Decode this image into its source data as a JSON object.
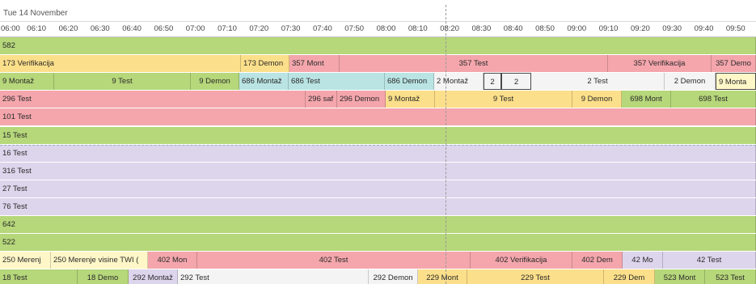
{
  "date_label": "Tue 14 November",
  "colors": {
    "green": "#b6d77a",
    "yellow": "#fcdf8a",
    "red": "#f4a6ac",
    "purple": "#ddd5ec",
    "cyan": "#b9e4e3",
    "white": "#f4f4f4",
    "yellow_light": "#fff7c8"
  },
  "time_ticks": [
    "06:00",
    "06:10",
    "06:20",
    "06:30",
    "06:40",
    "06:50",
    "07:00",
    "07:10",
    "07:20",
    "07:30",
    "07:40",
    "07:50",
    "08:00",
    "08:10",
    "08:20",
    "08:30",
    "08:40",
    "08:50",
    "09:00",
    "09:10",
    "09:20",
    "09:30",
    "09:40",
    "09:50"
  ],
  "rows": [
    {
      "segments": [
        {
          "text": "582",
          "color": "green",
          "start": 0,
          "end": 935,
          "align": "left"
        }
      ]
    },
    {
      "segments": [
        {
          "text": "173 Verifikacija",
          "color": "yellow",
          "start": 0,
          "end": 298,
          "align": "left"
        },
        {
          "text": "173 Demon",
          "color": "yellow",
          "start": 298,
          "end": 358,
          "align": "left"
        },
        {
          "text": "357 Mont",
          "color": "red",
          "start": 358,
          "end": 420,
          "align": "left"
        },
        {
          "text": "357 Test",
          "color": "red",
          "start": 420,
          "end": 752,
          "align": "center"
        },
        {
          "text": "357 Verifikacija",
          "color": "red",
          "start": 752,
          "end": 880,
          "align": "center"
        },
        {
          "text": "357 Demo",
          "color": "red",
          "start": 880,
          "end": 935,
          "align": "center"
        }
      ]
    },
    {
      "segments": [
        {
          "text": "9 Montaž",
          "color": "green",
          "start": 0,
          "end": 67,
          "align": "left"
        },
        {
          "text": "9 Test",
          "color": "green",
          "start": 67,
          "end": 236,
          "align": "center"
        },
        {
          "text": "9 Demon",
          "color": "green",
          "start": 236,
          "end": 296,
          "align": "center"
        },
        {
          "text": "686 Montaž",
          "color": "cyan",
          "start": 296,
          "end": 357,
          "align": "left"
        },
        {
          "text": "686 Test",
          "color": "cyan",
          "start": 357,
          "end": 476,
          "align": "left"
        },
        {
          "text": "686 Demon",
          "color": "cyan",
          "start": 476,
          "end": 537,
          "align": "left"
        },
        {
          "text": "2 Montaž",
          "color": "white",
          "start": 537,
          "end": 598,
          "align": "left"
        },
        {
          "text": "2",
          "color": "white",
          "start": 598,
          "end": 620,
          "align": "center",
          "selected": true
        },
        {
          "text": "2",
          "color": "white",
          "start": 620,
          "end": 657,
          "align": "center",
          "selected": true
        },
        {
          "text": "2 Test",
          "color": "white",
          "start": 657,
          "end": 822,
          "align": "center"
        },
        {
          "text": "2 Demon",
          "color": "white",
          "start": 822,
          "end": 885,
          "align": "center"
        },
        {
          "text": "9 Monta",
          "color": "yellow_light",
          "start": 885,
          "end": 935,
          "align": "left",
          "selected": true
        }
      ]
    },
    {
      "segments": [
        {
          "text": "296 Test",
          "color": "red",
          "start": 0,
          "end": 378,
          "align": "left"
        },
        {
          "text": "296 saf",
          "color": "red",
          "start": 378,
          "end": 417,
          "align": "left"
        },
        {
          "text": "296 Demon",
          "color": "red",
          "start": 417,
          "end": 477,
          "align": "left"
        },
        {
          "text": "9 Montaž",
          "color": "yellow",
          "start": 477,
          "end": 538,
          "align": "left"
        },
        {
          "text": "9 Test",
          "color": "yellow",
          "start": 538,
          "end": 708,
          "align": "center"
        },
        {
          "text": "9 Demon",
          "color": "yellow",
          "start": 708,
          "end": 769,
          "align": "center"
        },
        {
          "text": "698 Mont",
          "color": "green",
          "start": 769,
          "end": 830,
          "align": "center"
        },
        {
          "text": "698 Test",
          "color": "green",
          "start": 830,
          "end": 935,
          "align": "center"
        }
      ]
    },
    {
      "segments": [
        {
          "text": "101 Test",
          "color": "red",
          "start": 0,
          "end": 935,
          "align": "left"
        }
      ]
    },
    {
      "segments": [
        {
          "text": "15 Test",
          "color": "green",
          "start": 0,
          "end": 935,
          "align": "left"
        }
      ]
    },
    {
      "segments": [
        {
          "text": "16 Test",
          "color": "purple",
          "start": 0,
          "end": 935,
          "align": "left"
        }
      ]
    },
    {
      "segments": [
        {
          "text": "316 Test",
          "color": "purple",
          "start": 0,
          "end": 935,
          "align": "left"
        }
      ]
    },
    {
      "segments": [
        {
          "text": "27 Test",
          "color": "purple",
          "start": 0,
          "end": 935,
          "align": "left"
        }
      ]
    },
    {
      "segments": [
        {
          "text": "76 Test",
          "color": "purple",
          "start": 0,
          "end": 935,
          "align": "left"
        }
      ]
    },
    {
      "segments": [
        {
          "text": "642",
          "color": "green",
          "start": 0,
          "end": 935,
          "align": "left"
        }
      ]
    },
    {
      "segments": [
        {
          "text": "522",
          "color": "green",
          "start": 0,
          "end": 935,
          "align": "left"
        }
      ]
    },
    {
      "segments": [
        {
          "text": "250 Merenj",
          "color": "yellow_light",
          "start": 0,
          "end": 63,
          "align": "left"
        },
        {
          "text": "250 Merenje visine TWI (",
          "color": "yellow_light",
          "start": 63,
          "end": 183,
          "align": "left"
        },
        {
          "text": "402 Mon",
          "color": "red",
          "start": 183,
          "end": 244,
          "align": "center"
        },
        {
          "text": "402 Test",
          "color": "red",
          "start": 244,
          "end": 582,
          "align": "center"
        },
        {
          "text": "402 Verifikacija",
          "color": "red",
          "start": 582,
          "end": 708,
          "align": "center"
        },
        {
          "text": "402 Dem",
          "color": "red",
          "start": 708,
          "end": 770,
          "align": "center"
        },
        {
          "text": "42 Mo",
          "color": "purple",
          "start": 770,
          "end": 820,
          "align": "center"
        },
        {
          "text": "42 Test",
          "color": "purple",
          "start": 820,
          "end": 935,
          "align": "center"
        }
      ]
    },
    {
      "segments": [
        {
          "text": "18 Test",
          "color": "green",
          "start": 0,
          "end": 96,
          "align": "left"
        },
        {
          "text": "18 Demo",
          "color": "green",
          "start": 96,
          "end": 159,
          "align": "center"
        },
        {
          "text": "292 Montaž",
          "color": "purple",
          "start": 159,
          "end": 220,
          "align": "center"
        },
        {
          "text": "292 Test",
          "color": "white",
          "start": 220,
          "end": 456,
          "align": "left"
        },
        {
          "text": "292 Demon",
          "color": "white",
          "start": 456,
          "end": 517,
          "align": "center"
        },
        {
          "text": "229 Mont",
          "color": "yellow",
          "start": 517,
          "end": 578,
          "align": "center"
        },
        {
          "text": "229 Test",
          "color": "yellow",
          "start": 578,
          "end": 747,
          "align": "center"
        },
        {
          "text": "229 Dem",
          "color": "yellow",
          "start": 747,
          "end": 810,
          "align": "center"
        },
        {
          "text": "523 Mont",
          "color": "green",
          "start": 810,
          "end": 872,
          "align": "center"
        },
        {
          "text": "523 Test",
          "color": "green",
          "start": 872,
          "end": 935,
          "align": "center"
        }
      ]
    }
  ]
}
